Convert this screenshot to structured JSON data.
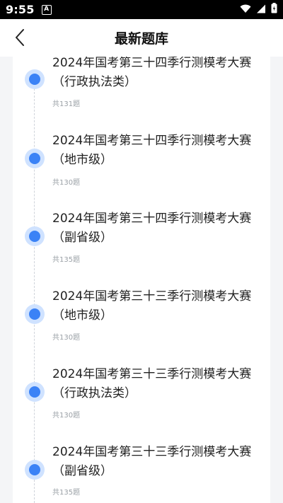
{
  "status_bar": {
    "time": "9:55",
    "notification_icon_letter": "A",
    "icons": [
      "wifi-icon",
      "signal-icon",
      "battery-icon"
    ]
  },
  "header": {
    "title": "最新题库",
    "back_icon": "chevron-left-icon"
  },
  "colors": {
    "accent": "#3b82f6",
    "accent_halo": "#cfe2ff",
    "count_text": "#9aa0a6",
    "timeline": "#cfd3da"
  },
  "items": [
    {
      "title_line1": "2024年国考第三十四季行测模考大赛",
      "title_line2": "（行政执法类）",
      "count": "共131题"
    },
    {
      "title_line1": "2024年国考第三十四季行测模考大赛",
      "title_line2": "（地市级）",
      "count": "共130题"
    },
    {
      "title_line1": "2024年国考第三十四季行测模考大赛",
      "title_line2": "（副省级）",
      "count": "共135题"
    },
    {
      "title_line1": "2024年国考第三十三季行测模考大赛",
      "title_line2": "（地市级）",
      "count": "共130题"
    },
    {
      "title_line1": "2024年国考第三十三季行测模考大赛",
      "title_line2": "（行政执法类）",
      "count": "共130题"
    },
    {
      "title_line1": "2024年国考第三十三季行测模考大赛",
      "title_line2": "（副省级）",
      "count": "共135题"
    }
  ]
}
